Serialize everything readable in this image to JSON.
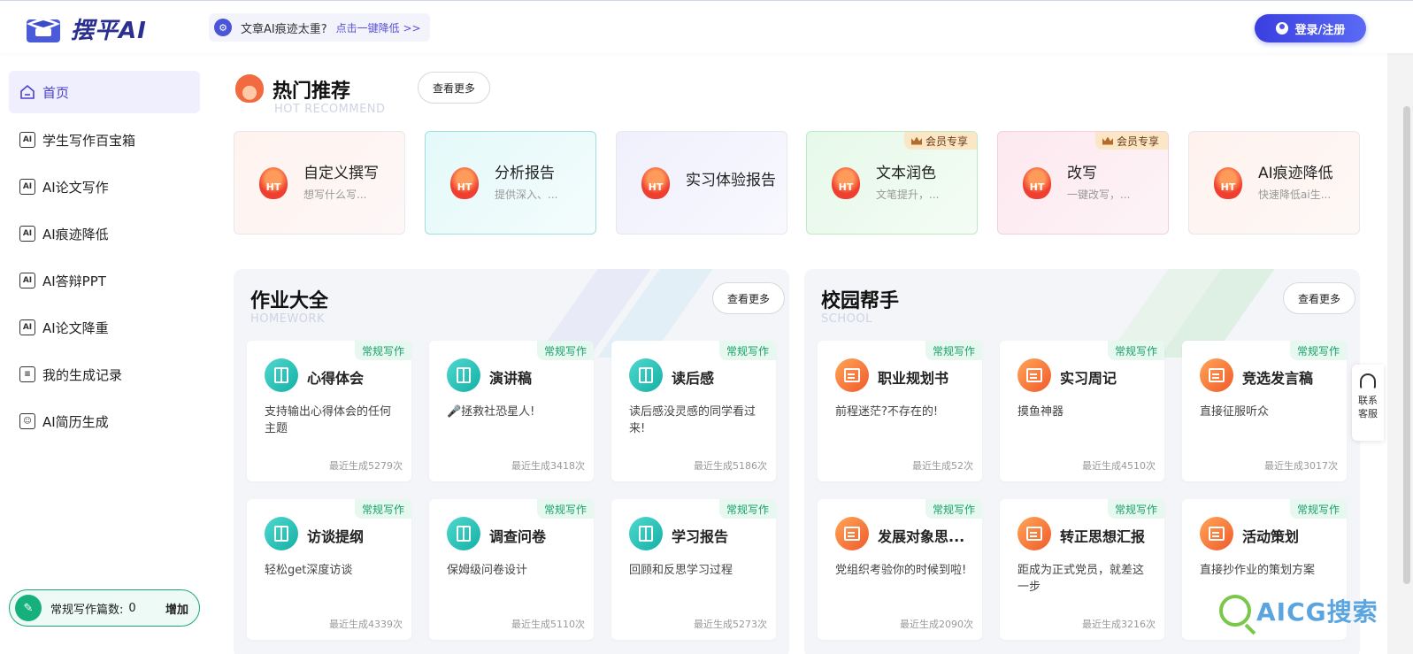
{
  "header": {
    "brand": "摆平AI",
    "notice_icon": "gear-badge-icon",
    "notice_text": "文章AI痕迹太重?",
    "notice_link": "点击一键降低 >>",
    "login_label": "登录/注册"
  },
  "sidebar": {
    "items": [
      {
        "label": "首页",
        "icon": "home-icon"
      },
      {
        "label": "学生写作百宝箱",
        "icon": "ai-doc-icon"
      },
      {
        "label": "AI论文写作",
        "icon": "ai-doc-icon"
      },
      {
        "label": "AI痕迹降低",
        "icon": "ai-doc-icon"
      },
      {
        "label": "AI答辩PPT",
        "icon": "ai-doc-icon"
      },
      {
        "label": "AI论文降重",
        "icon": "ai-doc-icon"
      },
      {
        "label": "我的生成记录",
        "icon": "record-icon"
      },
      {
        "label": "AI简历生成",
        "icon": "resume-icon"
      }
    ],
    "counter": {
      "label": "常规写作篇数:",
      "value": "0",
      "add_label": "增加"
    }
  },
  "hot": {
    "title": "热门推荐",
    "subtitle": "HOT RECOMMEND",
    "more_label": "查看更多",
    "badge": "HT",
    "vip_label": "会员专享",
    "cards": [
      {
        "title": "自定义撰写",
        "desc": "想写什么写...",
        "vip": false
      },
      {
        "title": "分析报告",
        "desc": "提供深入、...",
        "vip": false
      },
      {
        "title": "实习体验报告",
        "desc": "",
        "vip": false
      },
      {
        "title": "文本润色",
        "desc": "文笔提升，...",
        "vip": true
      },
      {
        "title": "改写",
        "desc": "一键改写，...",
        "vip": true
      },
      {
        "title": "AI痕迹降低",
        "desc": "快速降低ai生...",
        "vip": false
      }
    ]
  },
  "homework": {
    "title": "作业大全",
    "subtitle": "HOMEWORK",
    "more_label": "查看更多",
    "tag": "常规写作",
    "cards": [
      {
        "title": "心得体会",
        "desc": "支持输出心得体会的任何主题",
        "count": "最近生成5279次"
      },
      {
        "title": "演讲稿",
        "desc": "🎤拯救社恐星人!",
        "count": "最近生成3418次"
      },
      {
        "title": "读后感",
        "desc": "读后感没灵感的同学看过来!",
        "count": "最近生成5186次"
      },
      {
        "title": "访谈提纲",
        "desc": "轻松get深度访谈",
        "count": "最近生成4339次"
      },
      {
        "title": "调查问卷",
        "desc": "保姆级问卷设计",
        "count": "最近生成5110次"
      },
      {
        "title": "学习报告",
        "desc": "回顾和反思学习过程",
        "count": "最近生成5273次"
      }
    ]
  },
  "school": {
    "title": "校园帮手",
    "subtitle": "SCHOOL",
    "more_label": "查看更多",
    "tag": "常规写作",
    "cards": [
      {
        "title": "职业规划书",
        "desc": "前程迷茫?不存在的!",
        "count": "最近生成52次"
      },
      {
        "title": "实习周记",
        "desc": "摸鱼神器",
        "count": "最近生成4510次"
      },
      {
        "title": "竞选发言稿",
        "desc": "直接征服听众",
        "count": "最近生成3017次"
      },
      {
        "title": "发展对象思...",
        "desc": "党组织考验你的时候到啦!",
        "count": "最近生成2090次"
      },
      {
        "title": "转正思想汇报",
        "desc": "距成为正式党员，就差这一步",
        "count": "最近生成3216次"
      },
      {
        "title": "活动策划",
        "desc": "直接抄作业的策划方案",
        "count": ""
      }
    ]
  },
  "service": {
    "label": "联系客服"
  },
  "watermark": {
    "text": "AICG搜索"
  }
}
